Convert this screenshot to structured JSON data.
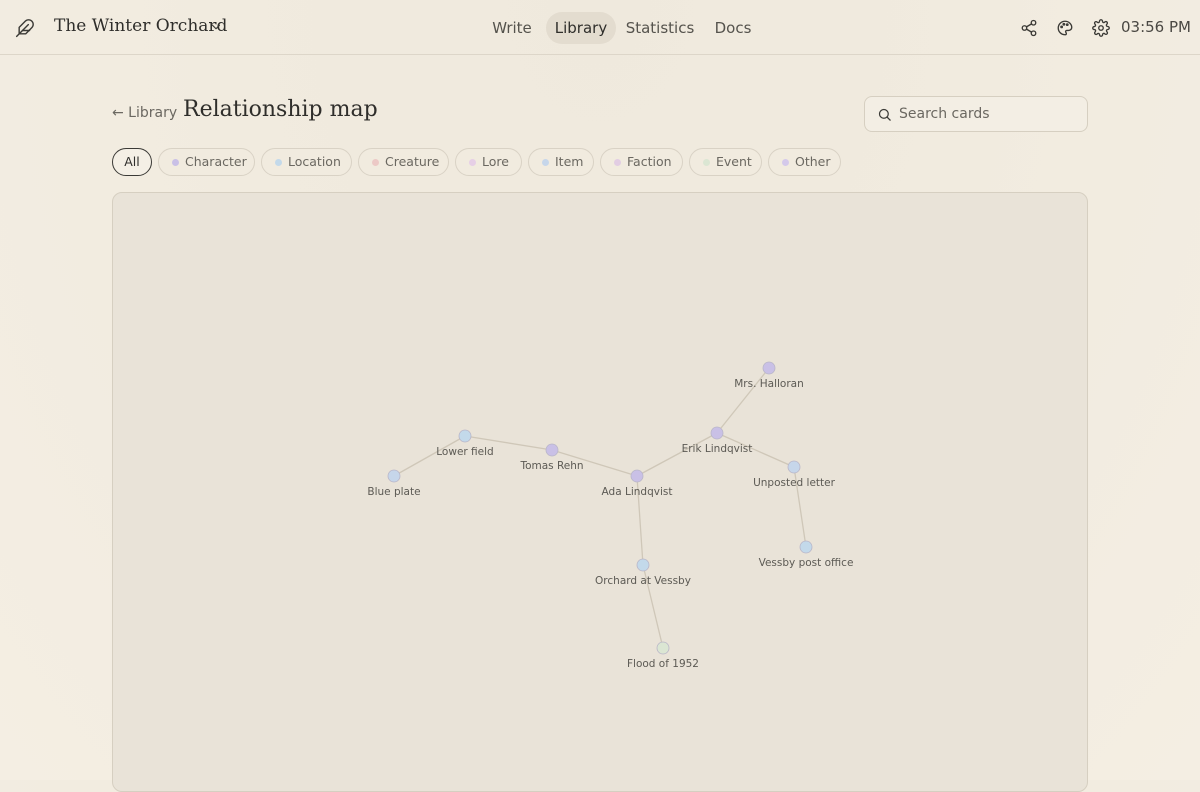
{
  "header": {
    "project_title": "The Winter Orchard",
    "nav": [
      "Write",
      "Library",
      "Statistics",
      "Docs"
    ],
    "active_nav": "Library",
    "time": "03:56 PM"
  },
  "page": {
    "back_label": "← Library",
    "title": "Relationship map",
    "search_placeholder": "Search cards"
  },
  "filters": [
    {
      "label": "All"
    },
    {
      "label": "Character",
      "color": "#c9c0e6"
    },
    {
      "label": "Location",
      "color": "#c3d9ea"
    },
    {
      "label": "Creature",
      "color": "#ecc9c6"
    },
    {
      "label": "Lore",
      "color": "#e6cfe6"
    },
    {
      "label": "Item",
      "color": "#c6d6ea"
    },
    {
      "label": "Faction",
      "color": "#e2cde3"
    },
    {
      "label": "Event",
      "color": "#dbe6d3"
    },
    {
      "label": "Other",
      "color": "#d4c9ea"
    }
  ],
  "graph": {
    "nodes": [
      {
        "id": "mrs-halloran",
        "label": "Mrs. Halloran",
        "type": "Character"
      },
      {
        "id": "erik",
        "label": "Erik Lindqvist",
        "type": "Character"
      },
      {
        "id": "lower-field",
        "label": "Lower field",
        "type": "Location"
      },
      {
        "id": "tomas",
        "label": "Tomas Rehn",
        "type": "Character"
      },
      {
        "id": "blue-plate",
        "label": "Blue plate",
        "type": "Item"
      },
      {
        "id": "ada",
        "label": "Ada Lindqvist",
        "type": "Character"
      },
      {
        "id": "letter",
        "label": "Unposted letter",
        "type": "Item"
      },
      {
        "id": "post-office",
        "label": "Vessby post office",
        "type": "Location"
      },
      {
        "id": "orchard",
        "label": "Orchard at Vessby",
        "type": "Location"
      },
      {
        "id": "flood",
        "label": "Flood of 1952",
        "type": "Event"
      }
    ],
    "edges": [
      [
        "mrs-halloran",
        "erik"
      ],
      [
        "erik",
        "ada"
      ],
      [
        "erik",
        "letter"
      ],
      [
        "letter",
        "post-office"
      ],
      [
        "ada",
        "tomas"
      ],
      [
        "tomas",
        "lower-field"
      ],
      [
        "lower-field",
        "blue-plate"
      ],
      [
        "ada",
        "orchard"
      ],
      [
        "orchard",
        "flood"
      ]
    ]
  }
}
